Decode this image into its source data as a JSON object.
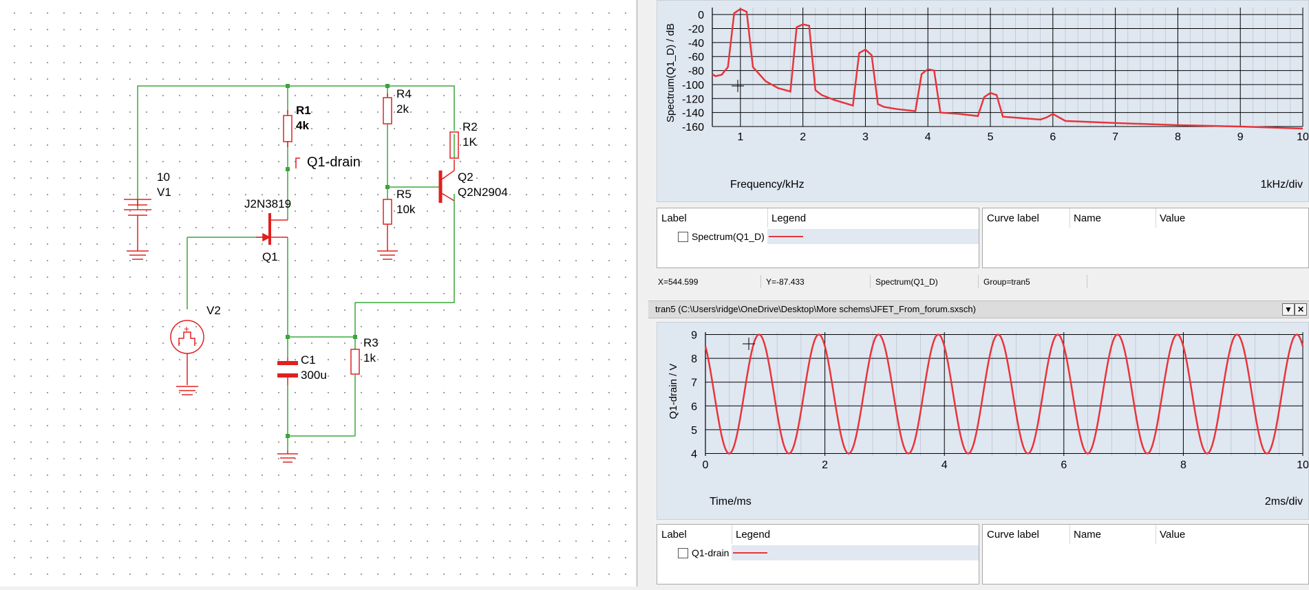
{
  "schematic": {
    "components": {
      "r1": {
        "name": "R1",
        "value": "4k"
      },
      "r2": {
        "name": "R2",
        "value": "1K"
      },
      "r3": {
        "name": "R3",
        "value": "1k"
      },
      "r4": {
        "name": "R4",
        "value": "2k"
      },
      "r5": {
        "name": "R5",
        "value": "10k"
      },
      "c1": {
        "name": "C1",
        "value": "300u"
      },
      "v1": {
        "name": "V1",
        "value": "10"
      },
      "v2": {
        "name": "V2"
      },
      "q1": {
        "name": "Q1",
        "model": "J2N3819"
      },
      "q2": {
        "name": "Q2",
        "model": "Q2N2904"
      }
    },
    "probe_label": "Q1-drain"
  },
  "spectrum_plot": {
    "ylabel": "Spectrum(Q1_D) / dB",
    "xlabel": "Frequency/kHz",
    "xdiv": "1kHz/div",
    "yticks": [
      "0",
      "-20",
      "-40",
      "-60",
      "-80",
      "-100",
      "-120",
      "-140",
      "-160"
    ],
    "xticks": [
      "1",
      "2",
      "3",
      "4",
      "5",
      "6",
      "7",
      "8",
      "9",
      "10"
    ]
  },
  "spectrum_legend": {
    "cols": {
      "label": "Label",
      "legend": "Legend",
      "curve_label": "Curve label",
      "name": "Name",
      "value": "Value"
    },
    "row": "Spectrum(Q1_D)"
  },
  "status": {
    "x": "X=544.599",
    "y": "Y=-87.433",
    "curve": "Spectrum(Q1_D)",
    "group": "Group=tran5"
  },
  "tran_window": {
    "title": "tran5 (C:\\Users\\ridge\\OneDrive\\Desktop\\More schems\\JFET_From_forum.sxsch)"
  },
  "tran_plot": {
    "ylabel": "Q1-drain / V",
    "xlabel": "Time/ms",
    "xdiv": "2ms/div",
    "yticks": [
      "9",
      "8",
      "7",
      "6",
      "5",
      "4"
    ],
    "xticks": [
      "0",
      "2",
      "4",
      "6",
      "8",
      "10"
    ]
  },
  "tran_legend": {
    "cols": {
      "label": "Label",
      "legend": "Legend",
      "curve_label": "Curve label",
      "name": "Name",
      "value": "Value"
    },
    "row": "Q1-drain"
  },
  "colors": {
    "curve": "#e8343a",
    "wire": "#3aa53a",
    "component": "#e02020",
    "plot_bg": "#dfe7f1"
  },
  "chart_data": [
    {
      "type": "line",
      "xlim": [
        0.55,
        10
      ],
      "ylim": [
        -160,
        10
      ],
      "series": [
        {
          "name": "Spectrum(Q1_D)",
          "x": [
            0.55,
            0.6,
            0.7,
            0.8,
            0.9,
            1.0,
            1.1,
            1.2,
            1.4,
            1.6,
            1.8,
            1.9,
            2.0,
            2.1,
            2.2,
            2.3,
            2.5,
            2.8,
            2.9,
            3.0,
            3.1,
            3.2,
            3.3,
            3.5,
            3.8,
            3.9,
            4.0,
            4.1,
            4.2,
            4.5,
            4.8,
            4.9,
            5.0,
            5.1,
            5.2,
            5.5,
            5.8,
            5.9,
            6.0,
            6.1,
            6.2,
            7.0,
            8.0,
            9.0,
            10.0
          ],
          "y": [
            -85,
            -88,
            -86,
            -75,
            2,
            8,
            4,
            -75,
            -95,
            -105,
            -110,
            -18,
            -14,
            -16,
            -108,
            -115,
            -122,
            -130,
            -55,
            -50,
            -58,
            -128,
            -132,
            -135,
            -138,
            -85,
            -78,
            -80,
            -140,
            -142,
            -145,
            -118,
            -112,
            -115,
            -146,
            -148,
            -150,
            -147,
            -142,
            -147,
            -152,
            -155,
            -158,
            -160,
            -163
          ]
        }
      ]
    },
    {
      "type": "line",
      "xlim": [
        0,
        10
      ],
      "ylim": [
        3.9,
        9.1
      ],
      "series": [
        {
          "name": "Q1-drain",
          "function": "6.5 + 2.5*sin(2*pi*t - 0.93) approx",
          "min": 4,
          "max": 9,
          "period_ms": 1,
          "cycles": 10
        }
      ]
    }
  ]
}
